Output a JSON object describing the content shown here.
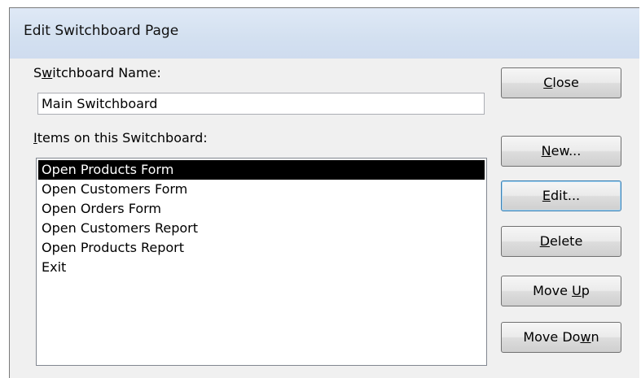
{
  "dialog": {
    "title": "Edit Switchboard Page"
  },
  "switchboard_name": {
    "label_pre": "S",
    "label_key": "w",
    "label_post": "itchboard Name:",
    "value": "Main Switchboard"
  },
  "items_section": {
    "label_key": "I",
    "label_post": "tems on this Switchboard:"
  },
  "items": [
    {
      "label": "Open Products Form",
      "selected": true
    },
    {
      "label": "Open Customers Form",
      "selected": false
    },
    {
      "label": "Open Orders Form",
      "selected": false
    },
    {
      "label": "Open Customers Report",
      "selected": false
    },
    {
      "label": "Open Products Report",
      "selected": false
    },
    {
      "label": "Exit",
      "selected": false
    }
  ],
  "buttons": {
    "close": {
      "key": "C",
      "post": "lose"
    },
    "new": {
      "key": "N",
      "post": "ew..."
    },
    "edit": {
      "key": "E",
      "post": "dit..."
    },
    "delete": {
      "key": "D",
      "post": "elete"
    },
    "move_up": {
      "pre": "Move ",
      "key": "U",
      "post": "p"
    },
    "move_down": {
      "pre": "Move Do",
      "key": "w",
      "post": "n"
    }
  }
}
